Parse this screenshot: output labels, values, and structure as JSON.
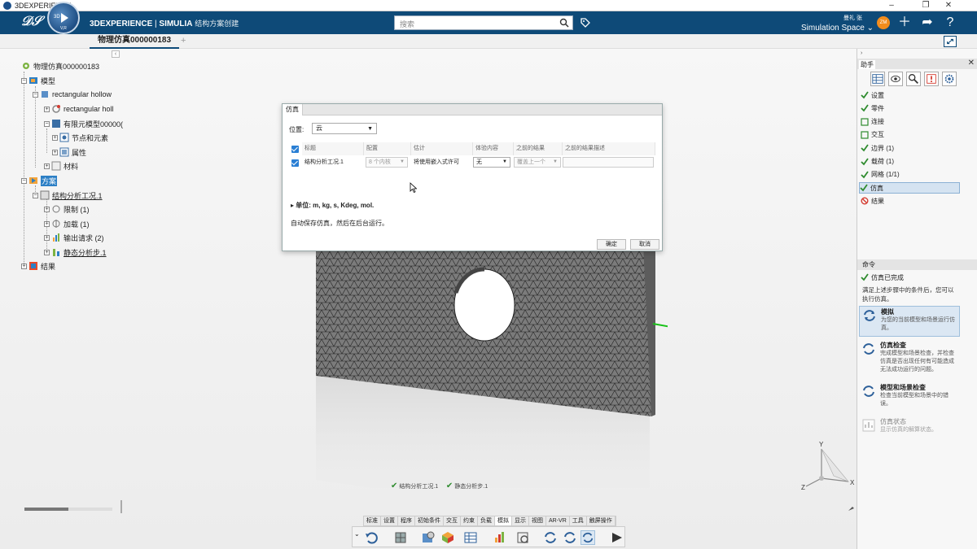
{
  "window": {
    "title": "3DEXPERIENCE"
  },
  "header": {
    "brand_strong": "3DEXPERIENCE",
    "brand_sep": " | ",
    "brand_app": "SIMULIA",
    "brand_sub": "结构方案创建",
    "search_placeholder": "搜索",
    "user_name": "曼礼 张",
    "space": "Simulation Space",
    "compass_label": "3D",
    "compass_vr": "V,R",
    "avatar_initials": "ZM"
  },
  "tabs": [
    {
      "label": "物理仿真000000183"
    }
  ],
  "tree": {
    "root": "物理仿真000000183",
    "model": "模型",
    "rect1": "rectangular hollow",
    "rect2": "rectangular holl",
    "fem": "有限元模型00000(",
    "nodes": "节点和元素",
    "props": "属性",
    "material": "材料",
    "scenario": "方案",
    "case": "结构分析工况.1",
    "restraint": "限制 (1)",
    "load": "加载 (1)",
    "output": "输出请求 (2)",
    "step": "静态分析步.1",
    "results": "结果"
  },
  "dialog": {
    "title": "仿真",
    "location_label": "位置:",
    "location_value": "云",
    "columns": [
      "标题",
      "配置",
      "估计",
      "体验内容",
      "之前的结果",
      "之前的结果描述"
    ],
    "row": {
      "title": "结构分析工况.1",
      "config": "8 个内核",
      "estimate": "将使用嵌入式许可",
      "experience": "无",
      "previous": "覆盖上一个"
    },
    "units": "单位: m, kg, s, Kdeg, mol.",
    "auto_save": "自动保存仿真，然后在后台运行。",
    "ok": "确定",
    "cancel": "取消"
  },
  "assistant": {
    "title": "助手",
    "steps": [
      {
        "label": "设置",
        "state": "done"
      },
      {
        "label": "零件",
        "state": "done"
      },
      {
        "label": "连接",
        "state": "empty"
      },
      {
        "label": "交互",
        "state": "empty"
      },
      {
        "label": "边界 (1)",
        "state": "done"
      },
      {
        "label": "载荷 (1)",
        "state": "done"
      },
      {
        "label": "网格 (1/1)",
        "state": "done"
      },
      {
        "label": "仿真",
        "state": "done"
      },
      {
        "label": "结果",
        "state": "blocked"
      }
    ],
    "command_title": "命令",
    "sim_done": "仿真已完成",
    "info": "满足上述步骤中的条件后，您可以执行仿真。",
    "commands": [
      {
        "title": "模拟",
        "desc": "为您的当前模型和场景运行仿真。"
      },
      {
        "title": "仿真检查",
        "desc": "完成模型和场景检查，并检查仿真是否出现任何有可能造成无法成功运行的问题。"
      },
      {
        "title": "模型和场景检查",
        "desc": "检查当前模型和场景中的错误。"
      },
      {
        "title": "仿真状态",
        "desc": "显示仿真的解算状态。"
      }
    ]
  },
  "status": {
    "case": "结构分析工况.1",
    "step": "静态分析步.1"
  },
  "toolbar_tabs": [
    "标准",
    "设置",
    "程序",
    "初始条件",
    "交互",
    "约束",
    "负载",
    "模拟",
    "显示",
    "视图",
    "AR-VR",
    "工具",
    "触屏操作"
  ],
  "axis": {
    "x": "X",
    "y": "Y",
    "z": "Z"
  },
  "colors": {
    "header": "#0e4a78",
    "accent": "#2a7fd4",
    "check": "#2e8b2e",
    "blocked": "#d43a2f"
  }
}
